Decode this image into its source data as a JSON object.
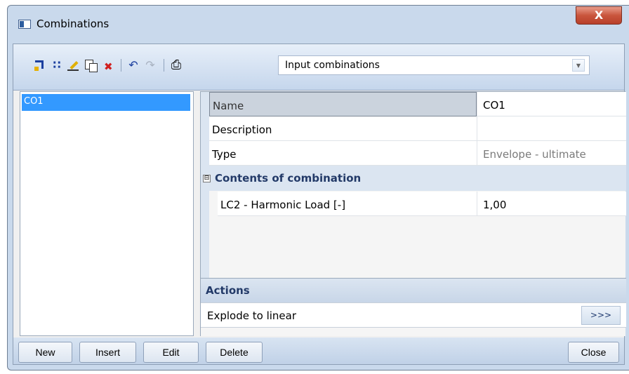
{
  "window": {
    "title": "Combinations",
    "close_glyph": "X"
  },
  "toolbar": {
    "icons": [
      "new-arrow-icon",
      "generate-icon",
      "edit-pencil-icon",
      "copy-icon",
      "delete-icon",
      "undo-icon",
      "redo-icon",
      "print-icon"
    ],
    "undo_glyph": "↶",
    "redo_glyph": "↷",
    "print_glyph": "⎙",
    "mode_select": {
      "value": "Input combinations"
    }
  },
  "list": {
    "items": [
      "CO1"
    ]
  },
  "properties": {
    "name": {
      "label": "Name",
      "value": "CO1"
    },
    "description": {
      "label": "Description",
      "value": ""
    },
    "type": {
      "label": "Type",
      "value": "Envelope - ultimate"
    },
    "section": {
      "toggle": "⊟",
      "title": "Contents of combination"
    },
    "contents": [
      {
        "label": "LC2 - Harmonic Load [-]",
        "value": "1,00"
      }
    ]
  },
  "actions": {
    "title": "Actions",
    "items": [
      {
        "label": "Explode to linear",
        "button": ">>>"
      }
    ]
  },
  "buttons": {
    "new": "New",
    "insert": "Insert",
    "edit": "Edit",
    "delete": "Delete",
    "close": "Close"
  }
}
